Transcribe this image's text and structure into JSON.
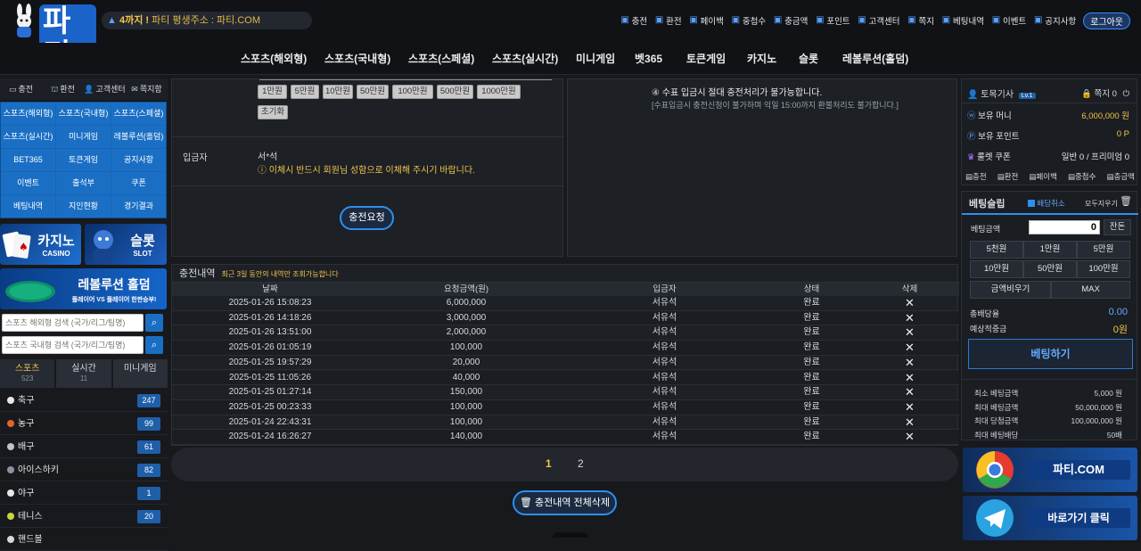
{
  "header": {
    "logo_text": "파티",
    "notice_prefix": "4까지 !",
    "notice_text": "파티 평생주소 : 파티.COM",
    "util_links": [
      {
        "label": "충전",
        "icon": "charge-icon"
      },
      {
        "label": "환전",
        "icon": "exchange-icon"
      },
      {
        "label": "페이백",
        "icon": "payback-icon"
      },
      {
        "label": "중첩수",
        "icon": "stack-icon"
      },
      {
        "label": "충금액",
        "icon": "amount-icon"
      },
      {
        "label": "포인트",
        "icon": "point-icon"
      },
      {
        "label": "고객센터",
        "icon": "support-icon"
      },
      {
        "label": "쪽지",
        "icon": "message-icon"
      },
      {
        "label": "베팅내역",
        "icon": "history-icon"
      },
      {
        "label": "이벤트",
        "icon": "event-icon"
      },
      {
        "label": "공지사항",
        "icon": "notice-icon"
      }
    ],
    "logout_label": "로그아웃"
  },
  "gnb": [
    "스포츠(해외형)",
    "스포츠(국내형)",
    "스포츠(스페셜)",
    "스포츠(실시간)",
    "미니게임",
    "벳365",
    "토큰게임",
    "카지노",
    "슬롯",
    "레볼루션(홀덤)"
  ],
  "left": {
    "quick": [
      "충전",
      "환전",
      "고객센터",
      "쪽지함"
    ],
    "grid": [
      "스포츠(해외형)",
      "스포츠(국내형)",
      "스포츠(스페셜)",
      "스포츠(실시간)",
      "미니게임",
      "레볼루션(홀덤)",
      "BET365",
      "토큰게임",
      "공지사항",
      "이벤트",
      "출석부",
      "쿠폰",
      "베팅내역",
      "지인현황",
      "경기결과"
    ],
    "banner_casino_title": "카지노",
    "banner_casino_sub": "CASINO",
    "banner_slot_title": "슬롯",
    "banner_slot_sub": "SLOT",
    "banner_holdem_title": "레볼루션 홀덤",
    "banner_holdem_sub": "플레이어 VS 플레이어 한판승부!",
    "search1_placeholder": "스포츠 해외형 검색 (국가/리그/팀명)",
    "search2_placeholder": "스포츠 국내형 검색 (국가/리그/팀명)",
    "tabs": [
      {
        "label": "스포츠",
        "count": "523"
      },
      {
        "label": "실시간",
        "count": "11"
      },
      {
        "label": "미니게임",
        "count": ""
      }
    ],
    "sports": [
      {
        "name": "축구",
        "count": "247",
        "color": "#e8e8e8"
      },
      {
        "name": "농구",
        "count": "99",
        "color": "#e0662a"
      },
      {
        "name": "배구",
        "count": "61",
        "color": "#bfc4cc"
      },
      {
        "name": "아이스하키",
        "count": "82",
        "color": "#8a93a3"
      },
      {
        "name": "야구",
        "count": "1",
        "color": "#e8e8e8"
      },
      {
        "name": "테니스",
        "count": "20",
        "color": "#c8d43a"
      },
      {
        "name": "핸드볼",
        "count": "",
        "color": "#d9d9d9"
      }
    ]
  },
  "deposit": {
    "amount_buttons": [
      "1만원",
      "5만원",
      "10만원",
      "50만원",
      "100만원",
      "500만원",
      "1000만원"
    ],
    "reset_label": "초기화",
    "depositor_label": "입금자",
    "depositor_value": "서*석",
    "depositor_warning": "이체시 반드시 회원님 성함으로 이체해 주시기 바랍니다.",
    "request_label": "충전요청",
    "notice_title": "④ 수표 입금시 절대 충전처리가 불가능합니다.",
    "notice_sub": "[수표입금시 충전신청이 불가하며 익일 15:00까지 환불처리도 불가합니다.]"
  },
  "history": {
    "title": "충전내역",
    "subtitle": "최근 3일 동안의 내역만 조회가능합니다",
    "columns": [
      "날짜",
      "요청금액(원)",
      "입금자",
      "상태",
      "삭제"
    ],
    "rows": [
      [
        "2025-01-26 15:08:23",
        "6,000,000",
        "서유석",
        "완료"
      ],
      [
        "2025-01-26 14:18:26",
        "3,000,000",
        "서유석",
        "완료"
      ],
      [
        "2025-01-26 13:51:00",
        "2,000,000",
        "서유석",
        "완료"
      ],
      [
        "2025-01-26 01:05:19",
        "100,000",
        "서유석",
        "완료"
      ],
      [
        "2025-01-25 19:57:29",
        "20,000",
        "서유석",
        "완료"
      ],
      [
        "2025-01-25 11:05:26",
        "40,000",
        "서유석",
        "완료"
      ],
      [
        "2025-01-25 01:27:14",
        "150,000",
        "서유석",
        "완료"
      ],
      [
        "2025-01-25 00:23:33",
        "100,000",
        "서유석",
        "완료"
      ],
      [
        "2025-01-24 22:43:31",
        "100,000",
        "서유석",
        "완료"
      ],
      [
        "2025-01-24 16:26:27",
        "140,000",
        "서유석",
        "완료"
      ]
    ],
    "pages": [
      "1",
      "2"
    ],
    "delete_all_label": "충전내역 전체삭제"
  },
  "user": {
    "name": "토목기사",
    "level": "Lv.1",
    "message_label": "쪽지 0",
    "money_label": "보유 머니",
    "money_value": "6,000,000 원",
    "point_label": "보유 포인트",
    "point_value": "0 P",
    "coupon_label": "룰렛 쿠폰",
    "coupon_value": "일반 0 / 프리미엄 0",
    "mini_links": [
      "충전",
      "환전",
      "페이백",
      "중첩수",
      "충금액"
    ]
  },
  "slip": {
    "title": "베팅슬립",
    "auto_label": "배당취소",
    "clear_label": "모두지우기",
    "bet_amount_label": "베팅금액",
    "bet_amount_value": "0",
    "remain_label": "잔돈",
    "quick_amounts": [
      "5천원",
      "1만원",
      "5만원",
      "10만원",
      "50만원",
      "100만원"
    ],
    "reset_label": "금액비우기",
    "max_label": "MAX",
    "total_odds_label": "총배당율",
    "total_odds_value": "0.00",
    "expected_label": "예상적중금",
    "expected_value": "0원",
    "bet_button": "베팅하기",
    "limits": [
      {
        "label": "최소 베팅금액",
        "value": "5,000 원"
      },
      {
        "label": "최대 베팅금액",
        "value": "50,000,000 원"
      },
      {
        "label": "최대 당첨금액",
        "value": "100,000,000 원"
      },
      {
        "label": "최대 베팅배당",
        "value": "50배"
      }
    ]
  },
  "right_banners": [
    {
      "label": "파티.COM"
    },
    {
      "label": "바로가기 클릭"
    }
  ],
  "colors": {
    "accent": "#2d8ff0",
    "gold": "#f2c34e",
    "panel": "#1d2025"
  }
}
